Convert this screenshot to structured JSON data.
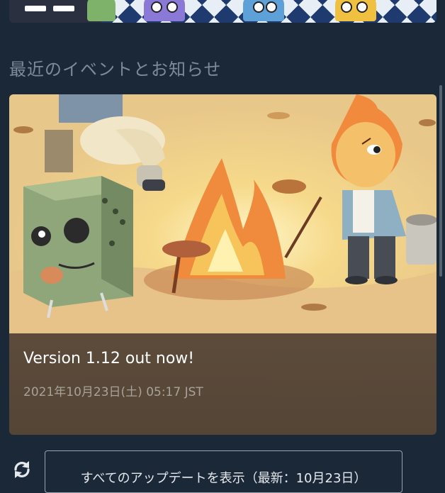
{
  "section": {
    "title": "最近のイベントとお知らせ"
  },
  "event": {
    "title": "Version 1.12 out now!",
    "date": "2021年10月23日(土) 05:17 JST",
    "image_icon": "event-art-image"
  },
  "footer": {
    "all_updates_label": "すべてのアップデートを表示（最新：10月23日）",
    "refresh_icon": "refresh-icon"
  },
  "colors": {
    "background": "#1b2838",
    "section_title": "#7c8a99",
    "card": "#6e5a48",
    "event_title": "#ffffff",
    "event_date": "#a7a29a"
  }
}
